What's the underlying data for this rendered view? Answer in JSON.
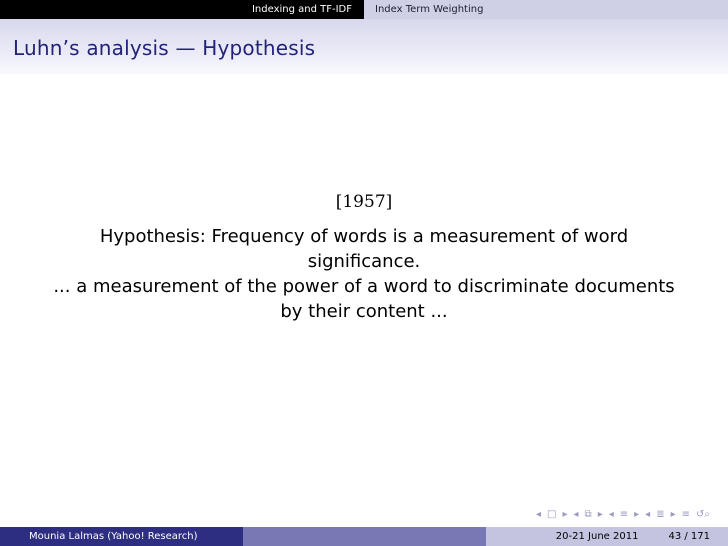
{
  "header": {
    "sections": [
      {
        "label": "Indexing and TF-IDF"
      },
      {
        "label": "Index Term Weighting"
      }
    ]
  },
  "frame": {
    "title": "Luhn’s analysis — Hypothesis"
  },
  "body": {
    "year": "[1957]",
    "hypothesis_line1": "Hypothesis: Frequency of words is a measurement of word",
    "hypothesis_line2": "significance.",
    "quote_line1": "... a measurement of the power of a word to discriminate documents",
    "quote_line2": "by their content ..."
  },
  "footer": {
    "author": "Mounia Lalmas  (Yahoo! Research)",
    "date": "20-21 June 2011",
    "page": "43 / 171"
  },
  "colors": {
    "title": "#23237a",
    "footer_left": "#2d2d82",
    "footer_mid": "#7878b4",
    "footer_right": "#c4c4e0",
    "nav_symbols": "#9a9ac2"
  },
  "icons": [
    "prev-frame-icon",
    "frame-icon",
    "next-frame-icon",
    "prev-subsection-icon",
    "next-subsection-icon",
    "prev-section-icon",
    "next-section-icon",
    "appendix-icon",
    "search-icon"
  ]
}
